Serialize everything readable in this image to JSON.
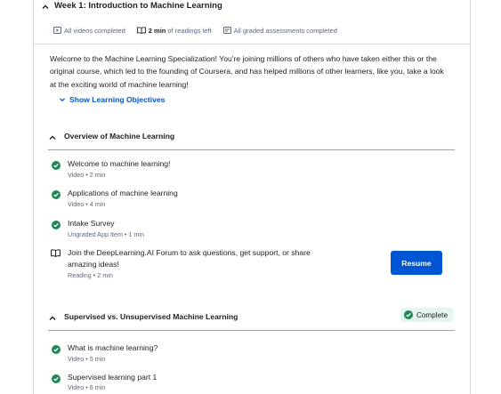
{
  "week": {
    "title": "Week 1: Introduction to Machine Learning",
    "stats": {
      "videos": "All videos completed",
      "readings_count": "2 min",
      "readings_rest": "of readings left",
      "assessments": "All graded assessments completed"
    }
  },
  "intro": "Welcome to the Machine Learning Specialization! You're joining millions of others who have taken either this or the original course, which led to the founding of Coursera, and has helped millions of other learners, like you, take a look at the exciting world of machine learning!",
  "show_objectives": "Show Learning Objectives",
  "sections": [
    {
      "title": "Overview of Machine Learning",
      "items": [
        {
          "name": "Welcome to machine learning!",
          "meta": "Video • 2 min",
          "status": "done"
        },
        {
          "name": "Applications of machine learning",
          "meta": "Video • 4 min",
          "status": "done"
        },
        {
          "name": "Intake Survey",
          "meta": "Ungraded App Item • 1 min",
          "status": "done"
        },
        {
          "name": "Join the DeepLearning.AI Forum to ask questions, get support, or share amazing ideas!",
          "meta": "Reading • 2 min",
          "status": "reading"
        }
      ],
      "action": "Resume"
    },
    {
      "title": "Supervised vs. Unsupervised Machine Learning",
      "badge": "Complete",
      "items": [
        {
          "name": "What is machine learning?",
          "meta": "Video • 5 min",
          "status": "done"
        },
        {
          "name": "Supervised learning part 1",
          "meta": "Video • 6 min",
          "status": "done"
        }
      ]
    }
  ],
  "colors": {
    "accent": "#0056d2",
    "success": "#1e8758",
    "complete_bg": "#e6f5ee"
  },
  "icons": [
    "chevron-up-icon",
    "chevron-down-icon",
    "video-icon",
    "book-icon",
    "assignment-icon",
    "check-circle-icon"
  ]
}
